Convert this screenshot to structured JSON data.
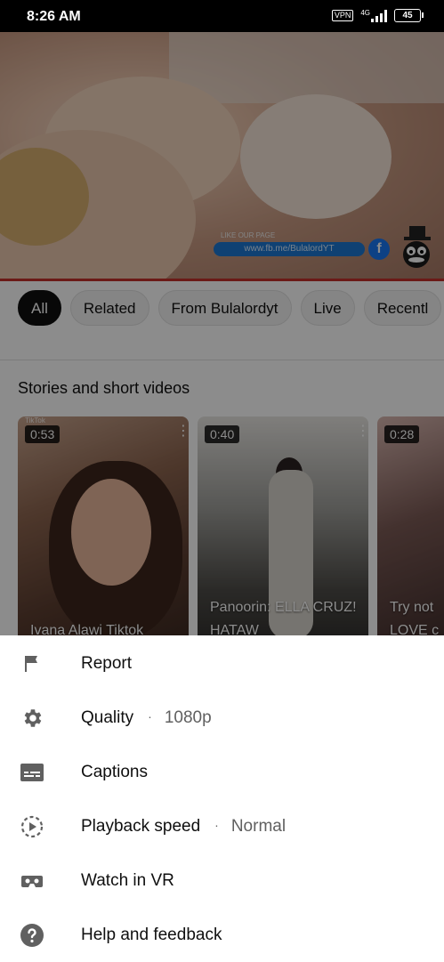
{
  "status_bar": {
    "time": "8:26 AM",
    "vpn": "VPN",
    "network": "4G",
    "battery": "45"
  },
  "video": {
    "banner_top": "LIKE OUR PAGE",
    "banner_url": "www.fb.me/BulalordYT",
    "fb_letter": "f"
  },
  "chips": [
    {
      "label": "All",
      "active": true
    },
    {
      "label": "Related"
    },
    {
      "label": "From Bulalordyt"
    },
    {
      "label": "Live"
    },
    {
      "label": "Recentl"
    }
  ],
  "shorts": {
    "title": "Stories and short videos",
    "items": [
      {
        "duration": "0:53",
        "title": "Ivana Alawi Tiktok",
        "tag": "TikTok"
      },
      {
        "duration": "0:40",
        "title": "Panoorin: ELLA CRUZ! HATAW"
      },
      {
        "duration": "0:28",
        "title": "Try not LOVE c"
      }
    ]
  },
  "menu": {
    "items": [
      {
        "label": "Report",
        "icon": "flag-icon"
      },
      {
        "label": "Quality",
        "value": "1080p",
        "icon": "gear-icon"
      },
      {
        "label": "Captions",
        "icon": "captions-icon"
      },
      {
        "label": "Playback speed",
        "value": "Normal",
        "icon": "playback-speed-icon"
      },
      {
        "label": "Watch in VR",
        "icon": "vr-icon"
      },
      {
        "label": "Help and feedback",
        "icon": "help-icon"
      }
    ],
    "separator": "·"
  },
  "colors": {
    "icon_gray": "#606060",
    "progress_red": "#c4302b",
    "chip_active": "#0f0f0f"
  }
}
